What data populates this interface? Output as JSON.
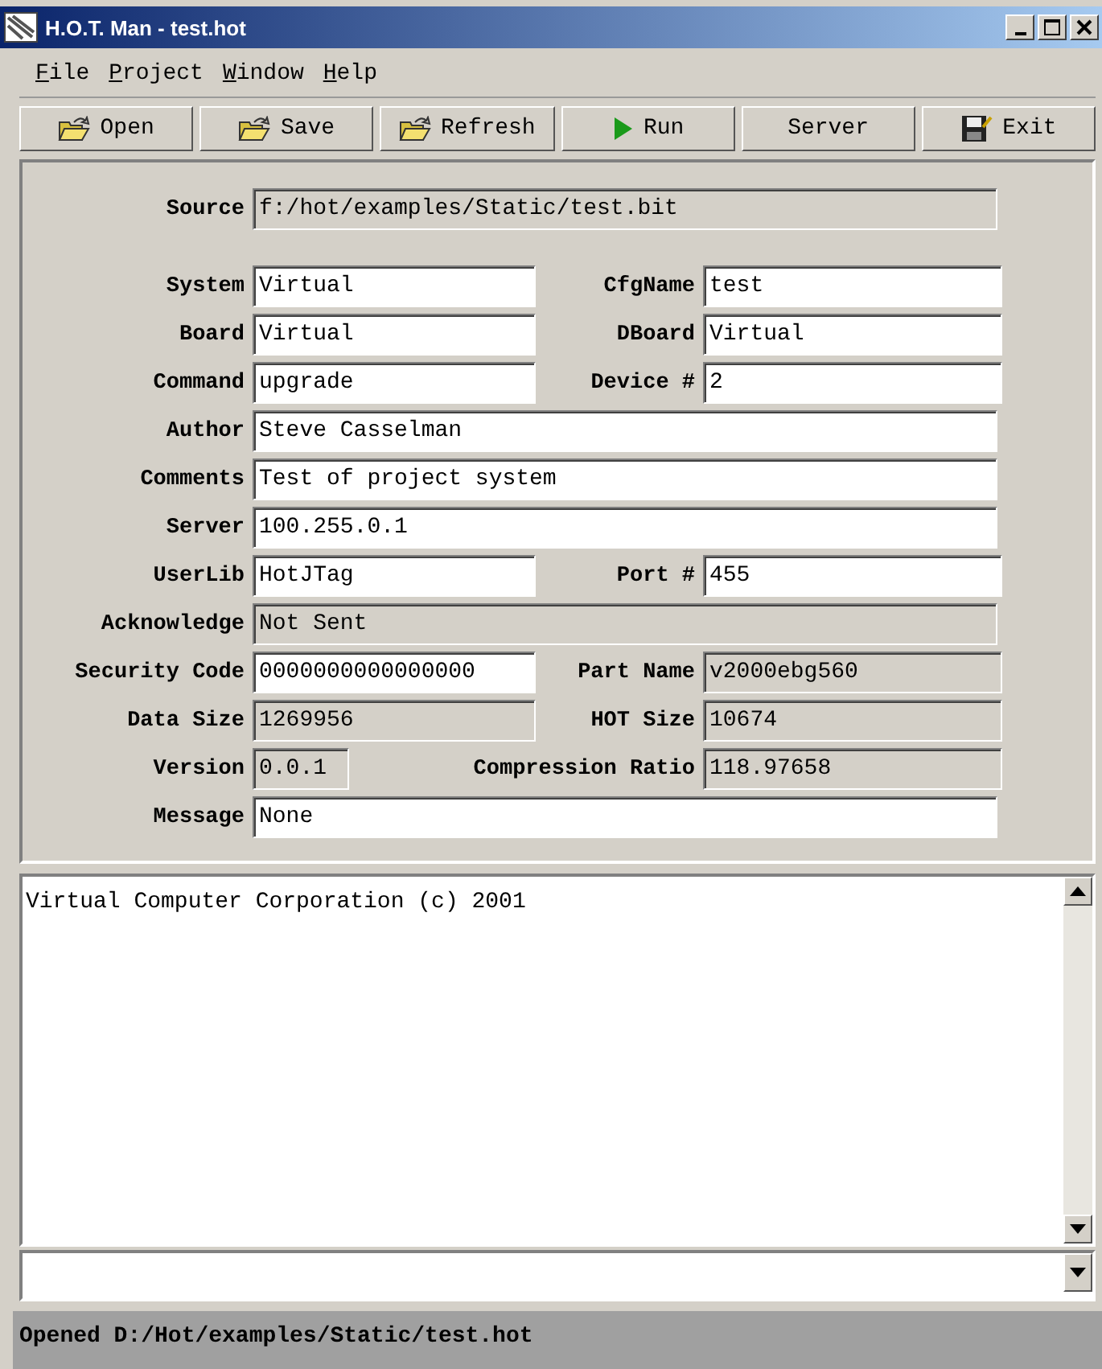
{
  "window": {
    "title": "H.O.T. Man - test.hot"
  },
  "menu": [
    "File",
    "Project",
    "Window",
    "Help"
  ],
  "toolbar": [
    {
      "label": "Open",
      "kind": "folder"
    },
    {
      "label": "Save",
      "kind": "folder"
    },
    {
      "label": "Refresh",
      "kind": "folder"
    },
    {
      "label": "Run",
      "kind": "play"
    },
    {
      "label": "Server",
      "kind": "text"
    },
    {
      "label": "Exit",
      "kind": "disk"
    }
  ],
  "form": [
    {
      "kind": "single",
      "label": "Source",
      "value": "f:/hot/examples/Static/test.bit",
      "editable": false
    },
    {
      "kind": "pair",
      "label": "System",
      "value": "Virtual",
      "editable": true,
      "label_2": "CfgName",
      "value_2": "test",
      "editable_2": true
    },
    {
      "kind": "pair",
      "label": "Board",
      "value": "Virtual",
      "editable": true,
      "label_2": "DBoard",
      "value_2": "Virtual",
      "editable_2": true
    },
    {
      "kind": "pair",
      "label": "Command",
      "value": "upgrade",
      "editable": true,
      "label_2": "Device #",
      "value_2": "2",
      "editable_2": true
    },
    {
      "kind": "single",
      "label": "Author",
      "value": "Steve Casselman",
      "editable": true
    },
    {
      "kind": "single",
      "label": "Comments",
      "value": "Test of project system",
      "editable": true
    },
    {
      "kind": "single",
      "label": "Server",
      "value": "100.255.0.1",
      "editable": true
    },
    {
      "kind": "pair",
      "label": "UserLib",
      "value": "HotJTag",
      "editable": true,
      "label_2": "Port #",
      "value_2": "455",
      "editable_2": true
    },
    {
      "kind": "single",
      "label": "Acknowledge",
      "value": "Not Sent",
      "editable": false
    },
    {
      "kind": "pair",
      "label": "Security Code",
      "value": "0000000000000000",
      "editable": true,
      "label_2": "Part Name",
      "value_2": "v2000ebg560",
      "editable_2": false
    },
    {
      "kind": "pair",
      "label": "Data Size",
      "value": "1269956",
      "editable": false,
      "label_2": "HOT Size",
      "value_2": "10674",
      "editable_2": false
    },
    {
      "kind": "pair-long-label",
      "label": "Version",
      "value": "0.0.1",
      "editable": false,
      "label_2": "Compression Ratio",
      "value_2": "118.97658",
      "editable_2": false
    },
    {
      "kind": "single",
      "label": "Message",
      "value": "None",
      "editable": true
    }
  ],
  "log": [
    "Virtual Computer Corporation (c) 2001"
  ],
  "status_bar": "Opened D:/Hot/examples/Static/test.hot"
}
